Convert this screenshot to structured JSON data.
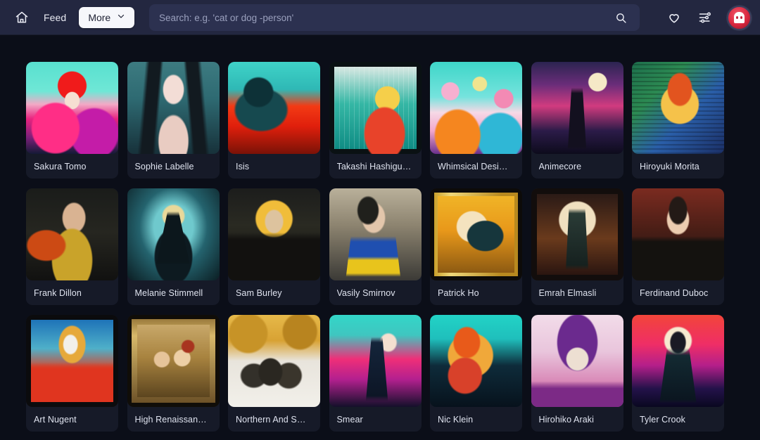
{
  "header": {
    "home_icon": "home-icon",
    "feed_label": "Feed",
    "more_label": "More",
    "more_chevron": "⌄",
    "search": {
      "placeholder": "Search: e.g. 'cat or dog -person'",
      "value": "",
      "submit_icon": "search-icon"
    },
    "favorites_icon": "heart-icon",
    "filters_icon": "sliders-icon",
    "avatar_icon": "user-avatar",
    "colors": {
      "bar_bg": "#232740",
      "search_bg": "#2c3150",
      "more_bg": "#f6f7fb",
      "avatar_accent": "#d8273f"
    }
  },
  "grid": {
    "columns": 7,
    "cards": [
      {
        "label": "Sakura Tomo",
        "art": "sakura"
      },
      {
        "label": "Sophie Labelle",
        "art": "sophie"
      },
      {
        "label": "Isis",
        "art": "isis"
      },
      {
        "label": "Takashi Hashigu…",
        "art": "takashi"
      },
      {
        "label": "Whimsical Desi…",
        "art": "whimsical"
      },
      {
        "label": "Animecore",
        "art": "animecore"
      },
      {
        "label": "Hiroyuki Morita",
        "art": "hiroyuki"
      },
      {
        "label": "Frank Dillon",
        "art": "frank"
      },
      {
        "label": "Melanie Stimmell",
        "art": "melanie"
      },
      {
        "label": "Sam Burley",
        "art": "sam"
      },
      {
        "label": "Vasily Smirnov",
        "art": "vasily"
      },
      {
        "label": "Patrick Ho",
        "art": "patrick"
      },
      {
        "label": "Emrah Elmasli",
        "art": "emrah"
      },
      {
        "label": "Ferdinand Duboc",
        "art": "ferdinand"
      },
      {
        "label": "Art Nugent",
        "art": "artn"
      },
      {
        "label": "High Renaissan…",
        "art": "high"
      },
      {
        "label": "Northern And S…",
        "art": "northern"
      },
      {
        "label": "Smear",
        "art": "smear"
      },
      {
        "label": "Nic Klein",
        "art": "nic"
      },
      {
        "label": "Hirohiko Araki",
        "art": "hirohiko"
      },
      {
        "label": "Tyler Crook",
        "art": "tyler"
      }
    ]
  }
}
